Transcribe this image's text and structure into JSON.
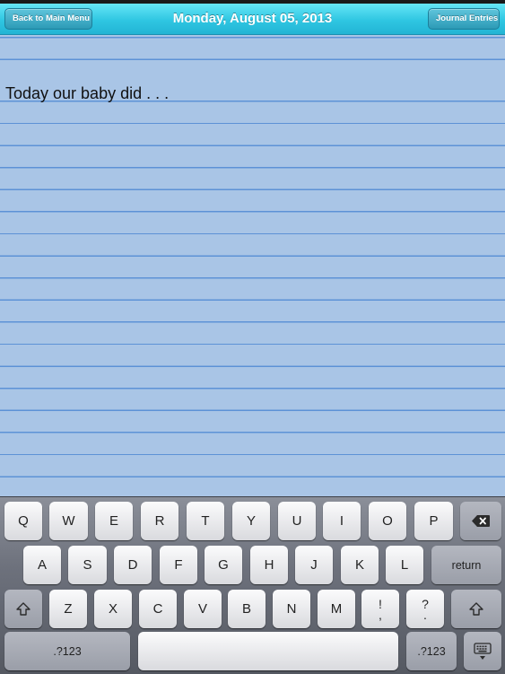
{
  "nav": {
    "title": "Monday, August 05, 2013",
    "back_label": "Back to Main Menu",
    "entries_label": "Journal Entries"
  },
  "journal": {
    "text": "Today our baby did . . ."
  },
  "keyboard": {
    "row1": [
      "Q",
      "W",
      "E",
      "R",
      "T",
      "Y",
      "U",
      "I",
      "O",
      "P"
    ],
    "row2": [
      "A",
      "S",
      "D",
      "F",
      "G",
      "H",
      "J",
      "K",
      "L"
    ],
    "row3": [
      "Z",
      "X",
      "C",
      "V",
      "B",
      "N",
      "M"
    ],
    "return_label": "return",
    "numbers_label": ".?123",
    "punct1_top": "!",
    "punct1_bottom": ",",
    "punct2_top": "?",
    "punct2_bottom": ".",
    "icons": {
      "backspace": "backspace-icon",
      "shift": "shift-icon",
      "hide_keyboard": "hide-keyboard-icon"
    }
  },
  "colors": {
    "nav_bar": "#2fc6e2",
    "paper": "#aac6e7",
    "rule_line": "#5d92d6"
  }
}
